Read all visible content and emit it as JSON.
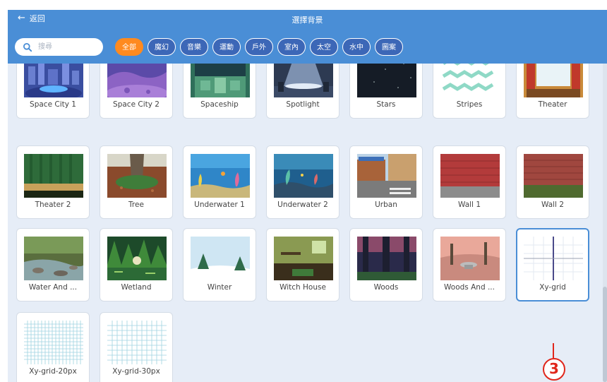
{
  "header": {
    "back_label": "返回",
    "title": "選擇背景"
  },
  "search": {
    "placeholder": "搜尋"
  },
  "filters": [
    {
      "label": "全部",
      "active": true
    },
    {
      "label": "魔幻",
      "active": false
    },
    {
      "label": "音樂",
      "active": false
    },
    {
      "label": "運動",
      "active": false
    },
    {
      "label": "戶外",
      "active": false
    },
    {
      "label": "室內",
      "active": false
    },
    {
      "label": "太空",
      "active": false
    },
    {
      "label": "水中",
      "active": false
    },
    {
      "label": "圖案",
      "active": false
    }
  ],
  "backdrops": [
    {
      "name": "Space City 1"
    },
    {
      "name": "Space City 2"
    },
    {
      "name": "Spaceship"
    },
    {
      "name": "Spotlight"
    },
    {
      "name": "Stars"
    },
    {
      "name": "Stripes"
    },
    {
      "name": "Theater"
    },
    {
      "name": "Theater 2"
    },
    {
      "name": "Tree"
    },
    {
      "name": "Underwater 1"
    },
    {
      "name": "Underwater 2"
    },
    {
      "name": "Urban"
    },
    {
      "name": "Wall 1"
    },
    {
      "name": "Wall 2"
    },
    {
      "name": "Water And ..."
    },
    {
      "name": "Wetland"
    },
    {
      "name": "Winter"
    },
    {
      "name": "Witch House"
    },
    {
      "name": "Woods"
    },
    {
      "name": "Woods And ..."
    },
    {
      "name": "Xy-grid",
      "selected": true
    },
    {
      "name": "Xy-grid-20px"
    },
    {
      "name": "Xy-grid-30px"
    }
  ],
  "callout": {
    "number": "3"
  },
  "colors": {
    "header": "#4a8ed6",
    "chip": "#3c67b7",
    "chip_active": "#ff8a1f",
    "callout": "#e0261b"
  }
}
